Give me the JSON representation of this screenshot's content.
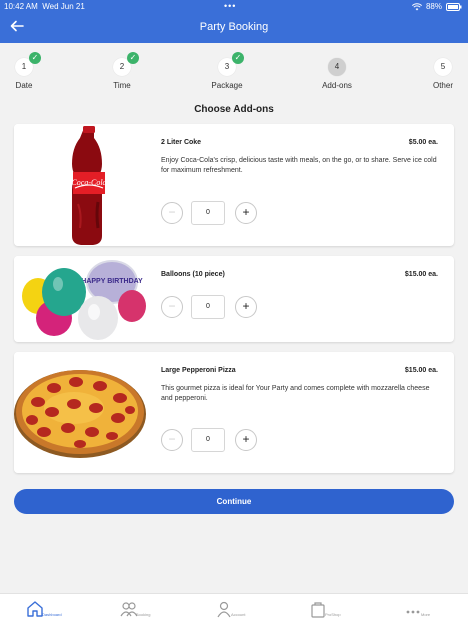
{
  "status_bar": {
    "time": "10:42 AM",
    "date": "Wed Jun 21",
    "battery": "88%"
  },
  "header": {
    "title": "Party Booking"
  },
  "steps": [
    {
      "number": "1",
      "label": "Date",
      "completed": true
    },
    {
      "number": "2",
      "label": "Time",
      "completed": true
    },
    {
      "number": "3",
      "label": "Package",
      "completed": true
    },
    {
      "number": "4",
      "label": "Add-ons",
      "completed": false,
      "active": true
    },
    {
      "number": "5",
      "label": "Other",
      "completed": false
    }
  ],
  "section_title": "Choose Add-ons",
  "addons": [
    {
      "name": "2 Liter Coke",
      "price": "$5.00 ea.",
      "description": "Enjoy Coca-Cola's crisp, delicious taste with meals, on the go, or to share. Serve ice cold for maximum refreshment.",
      "quantity": "0",
      "image_text": "Coca-Cola"
    },
    {
      "name": "Balloons (10 piece)",
      "price": "$15.00 ea.",
      "description": "",
      "quantity": "0",
      "image_text": "HAPPY BIRTHDAY"
    },
    {
      "name": "Large Pepperoni Pizza",
      "price": "$15.00 ea.",
      "description": "This gourmet pizza is ideal for Your Party and comes complete with mozzarella cheese and pepperoni.",
      "quantity": "0"
    }
  ],
  "continue_label": "Continue",
  "tabbar": [
    {
      "label": "Dashboard",
      "icon": "home-icon",
      "active": true
    },
    {
      "label": "Booking",
      "icon": "people-icon",
      "active": false
    },
    {
      "label": "Account",
      "icon": "person-icon",
      "active": false
    },
    {
      "label": "ProShop",
      "icon": "shopping-bag-icon",
      "active": false
    },
    {
      "label": "More",
      "icon": "more-dots-icon",
      "active": false
    }
  ],
  "colors": {
    "header": "#3a6fd8",
    "check": "#3cb36a",
    "button": "#2f63cf",
    "background": "#f2f2f2"
  }
}
